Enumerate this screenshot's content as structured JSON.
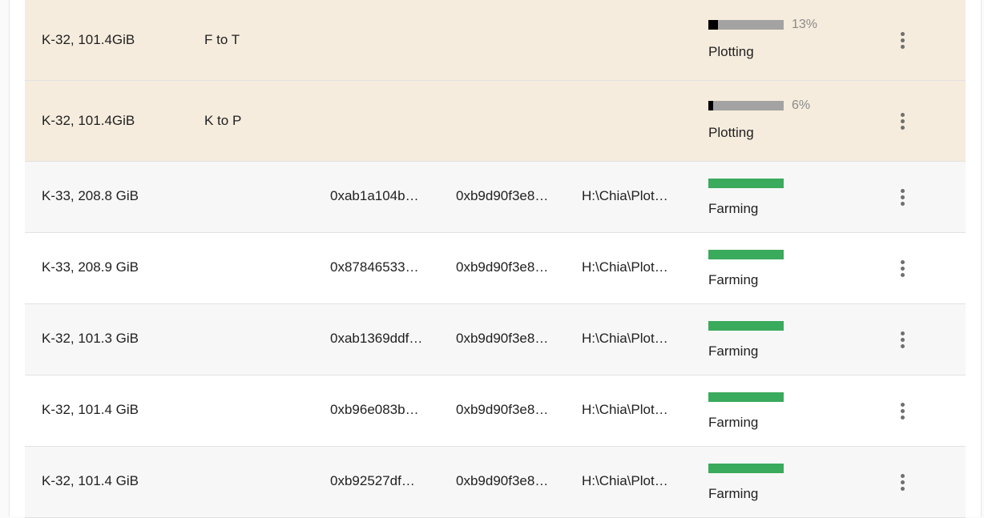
{
  "plots": [
    {
      "size": "K-32, 101.4GiB",
      "queue": "F to T",
      "pool_key": "",
      "farmer_key": "",
      "path": "",
      "status": "Plotting",
      "progress_text": "13%",
      "progress": 0.13,
      "state": "plotting"
    },
    {
      "size": "K-32, 101.4GiB",
      "queue": "K to P",
      "pool_key": "",
      "farmer_key": "",
      "path": "",
      "status": "Plotting",
      "progress_text": "6%",
      "progress": 0.06,
      "state": "plotting"
    },
    {
      "size": "K-33, 208.8 GiB",
      "queue": "",
      "pool_key": "0xab1a104b…",
      "farmer_key": "0xb9d90f3e8…",
      "path": "H:\\Chia\\Plot…",
      "status": "Farming",
      "progress_text": "",
      "progress": 1,
      "state": "farming"
    },
    {
      "size": "K-33, 208.9 GiB",
      "queue": "",
      "pool_key": "0x87846533…",
      "farmer_key": "0xb9d90f3e8…",
      "path": "H:\\Chia\\Plot…",
      "status": "Farming",
      "progress_text": "",
      "progress": 1,
      "state": "farming"
    },
    {
      "size": "K-32, 101.3 GiB",
      "queue": "",
      "pool_key": "0xab1369ddf…",
      "farmer_key": "0xb9d90f3e8…",
      "path": "H:\\Chia\\Plot…",
      "status": "Farming",
      "progress_text": "",
      "progress": 1,
      "state": "farming"
    },
    {
      "size": "K-32, 101.4 GiB",
      "queue": "",
      "pool_key": "0xb96e083b…",
      "farmer_key": "0xb9d90f3e8…",
      "path": "H:\\Chia\\Plot…",
      "status": "Farming",
      "progress_text": "",
      "progress": 1,
      "state": "farming"
    },
    {
      "size": "K-32, 101.4 GiB",
      "queue": "",
      "pool_key": "0xb92527df…",
      "farmer_key": "0xb9d90f3e8…",
      "path": "H:\\Chia\\Plot…",
      "status": "Farming",
      "progress_text": "",
      "progress": 1,
      "state": "farming"
    }
  ],
  "icons": {
    "row_menu": "more-vertical-icon"
  },
  "colors": {
    "plotting_row_bg": "#f5ecdd",
    "progress_fill": "#000000",
    "progress_track": "#a3a3a3",
    "farming_bar": "#3aaa5c"
  }
}
